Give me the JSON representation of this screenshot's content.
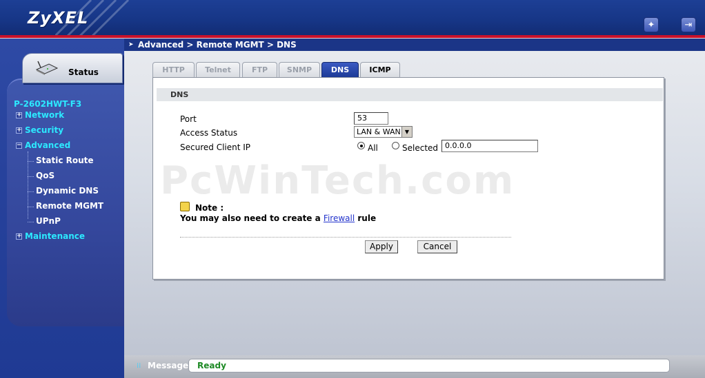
{
  "header": {
    "logo": "ZyXEL",
    "icons": [
      "wizard-icon",
      "logout-icon"
    ]
  },
  "sidebar": {
    "status_tab_label": "Status",
    "device_name": "P-2602HWT-F3",
    "items": [
      {
        "label": "Network",
        "level": "top",
        "expander": "+"
      },
      {
        "label": "Security",
        "level": "top",
        "expander": "+"
      },
      {
        "label": "Advanced",
        "level": "top",
        "expander": "−"
      },
      {
        "label": "Static Route",
        "level": "sub"
      },
      {
        "label": "QoS",
        "level": "sub"
      },
      {
        "label": "Dynamic DNS",
        "level": "sub"
      },
      {
        "label": "Remote MGMT",
        "level": "sub"
      },
      {
        "label": "UPnP",
        "level": "sub"
      },
      {
        "label": "Maintenance",
        "level": "top",
        "expander": "+"
      }
    ]
  },
  "breadcrumb": "Advanced > Remote MGMT > DNS",
  "tabs": [
    {
      "label": "HTTP"
    },
    {
      "label": "Telnet"
    },
    {
      "label": "FTP"
    },
    {
      "label": "SNMP"
    },
    {
      "label": "DNS",
      "active": true
    },
    {
      "label": "ICMP"
    }
  ],
  "panel": {
    "section_title": "DNS",
    "port_label": "Port",
    "port_value": "53",
    "access_label": "Access Status",
    "access_value": "LAN & WAN",
    "client_label": "Secured Client IP",
    "radio_all": "All",
    "radio_selected": "Selected",
    "client_ip_value": "0.0.0.0",
    "note_title": "Note :",
    "note_prefix": "You may also need to create a",
    "note_link": "Firewall",
    "note_suffix": "rule",
    "apply_label": "Apply",
    "cancel_label": "Cancel"
  },
  "watermark": "PcWinTech.com",
  "message": {
    "label": "Message",
    "text": "Ready"
  },
  "colors": {
    "header_blue": "#163585",
    "header_red_line": "#c8112a",
    "menu_cyan": "#2ce9ff",
    "active_tab": "#1c3a97",
    "ready_green": "#1e8a25"
  }
}
